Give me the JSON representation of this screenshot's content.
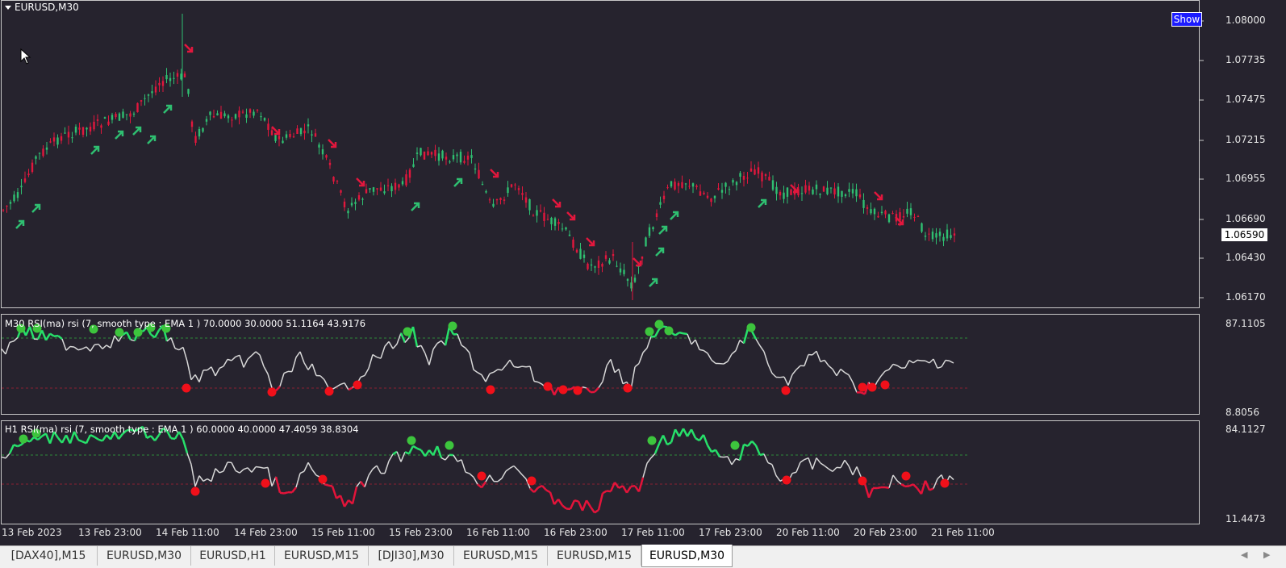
{
  "chart": {
    "symbol_title": "EURUSD,M30",
    "show_button": "Show",
    "current_price": "1.06590",
    "price_labels": [
      "1.08000",
      "1.07735",
      "1.07475",
      "1.07215",
      "1.06955",
      "1.06690",
      "1.06430",
      "1.06170"
    ],
    "colors": {
      "background": "#26232e",
      "bull": "#2fbf71",
      "bear": "#e2173d",
      "wick": "#cfcfcf"
    }
  },
  "indicator1": {
    "title": "M30 RSI(ma) rsi (7, smooth type : EMA  1 ) 70.0000 30.0000 51.1164 43.9176",
    "scale_high": "87.1105",
    "scale_low": "8.8056"
  },
  "indicator2": {
    "title": "H1 RSI(ma) rsi (7, smooth type : EMA  1 ) 60.0000 40.0000 47.4059 38.8304",
    "scale_high": "84.1127",
    "scale_low": "11.4473"
  },
  "time_axis": [
    "13 Feb 2023",
    "13 Feb 23:00",
    "14 Feb 11:00",
    "14 Feb 23:00",
    "15 Feb 11:00",
    "15 Feb 23:00",
    "16 Feb 11:00",
    "16 Feb 23:00",
    "17 Feb 11:00",
    "17 Feb 23:00",
    "20 Feb 11:00",
    "20 Feb 23:00",
    "21 Feb 11:00"
  ],
  "tabs": [
    {
      "label": "[DAX40],M15",
      "active": false
    },
    {
      "label": "EURUSD,M30",
      "active": false
    },
    {
      "label": "EURUSD,H1",
      "active": false
    },
    {
      "label": "EURUSD,M15",
      "active": false
    },
    {
      "label": "[DJI30],M30",
      "active": false
    },
    {
      "label": "EURUSD,M15",
      "active": false
    },
    {
      "label": "EURUSD,M15",
      "active": false
    },
    {
      "label": "EURUSD,M30",
      "active": true
    }
  ],
  "icons": {
    "collapse": "triangle-down-icon",
    "nav_left": "arrow-left-icon",
    "nav_right": "arrow-right-icon",
    "cursor": "mouse-pointer-icon"
  }
}
